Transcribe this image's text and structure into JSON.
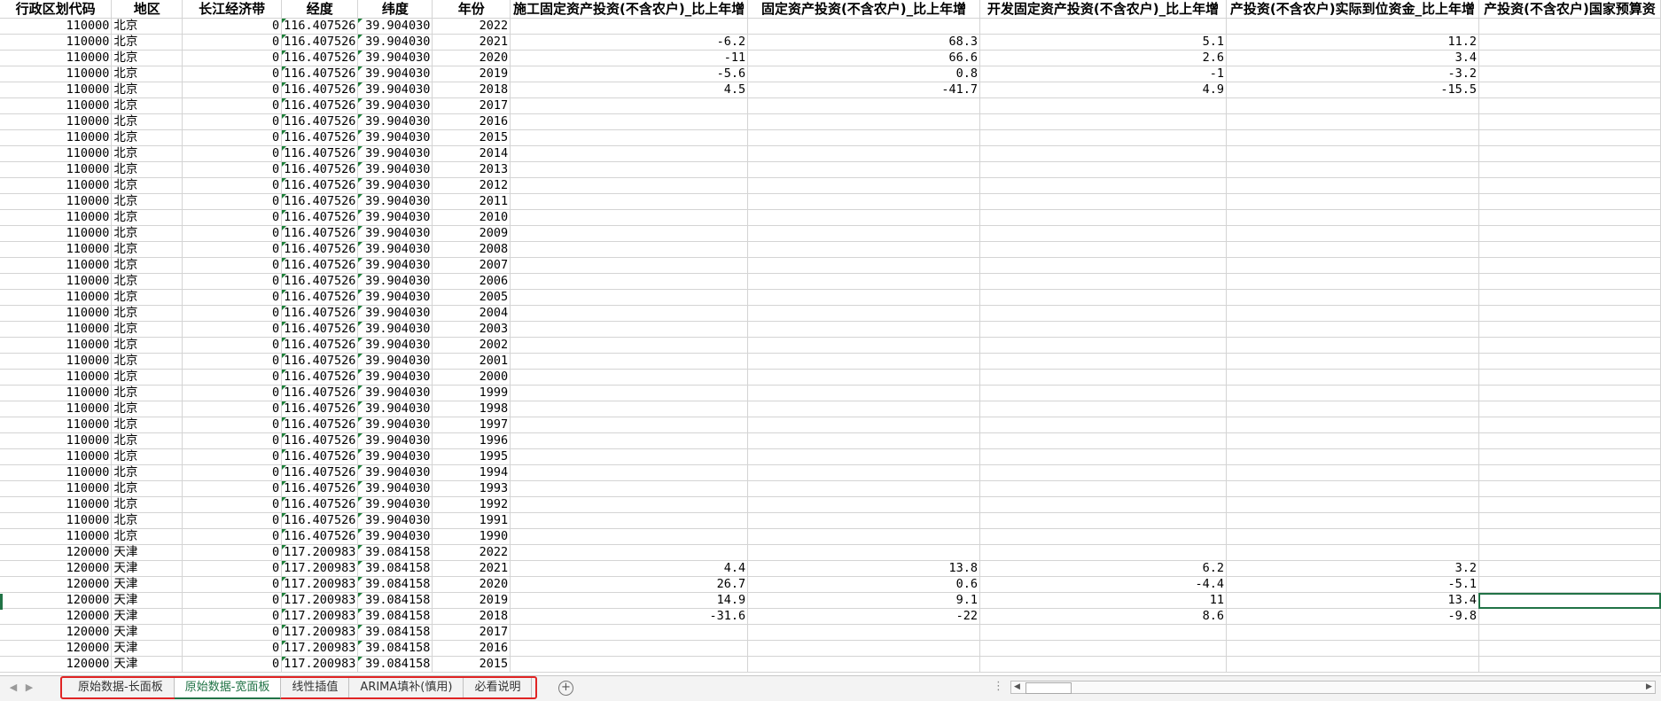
{
  "sheet": {
    "headers": [
      "行政区划代码",
      "地区",
      "长江经济带",
      "经度",
      "纬度",
      "年份",
      "施工固定资产投资(不含农户)_比上年增",
      "固定资产投资(不含农户)_比上年增",
      "开发固定资产投资(不含农户)_比上年增",
      "产投资(不含农户)实际到位资金_比上年增",
      "产投资(不含农户)国家预算资"
    ],
    "rows": [
      [
        "110000",
        "北京",
        "0",
        "116.407526",
        "39.904030",
        "2022",
        "",
        "",
        "",
        "",
        ""
      ],
      [
        "110000",
        "北京",
        "0",
        "116.407526",
        "39.904030",
        "2021",
        "-6.2",
        "68.3",
        "5.1",
        "11.2",
        ""
      ],
      [
        "110000",
        "北京",
        "0",
        "116.407526",
        "39.904030",
        "2020",
        "-11",
        "66.6",
        "2.6",
        "3.4",
        ""
      ],
      [
        "110000",
        "北京",
        "0",
        "116.407526",
        "39.904030",
        "2019",
        "-5.6",
        "0.8",
        "-1",
        "-3.2",
        ""
      ],
      [
        "110000",
        "北京",
        "0",
        "116.407526",
        "39.904030",
        "2018",
        "4.5",
        "-41.7",
        "4.9",
        "-15.5",
        ""
      ],
      [
        "110000",
        "北京",
        "0",
        "116.407526",
        "39.904030",
        "2017",
        "",
        "",
        "",
        "",
        ""
      ],
      [
        "110000",
        "北京",
        "0",
        "116.407526",
        "39.904030",
        "2016",
        "",
        "",
        "",
        "",
        ""
      ],
      [
        "110000",
        "北京",
        "0",
        "116.407526",
        "39.904030",
        "2015",
        "",
        "",
        "",
        "",
        ""
      ],
      [
        "110000",
        "北京",
        "0",
        "116.407526",
        "39.904030",
        "2014",
        "",
        "",
        "",
        "",
        ""
      ],
      [
        "110000",
        "北京",
        "0",
        "116.407526",
        "39.904030",
        "2013",
        "",
        "",
        "",
        "",
        ""
      ],
      [
        "110000",
        "北京",
        "0",
        "116.407526",
        "39.904030",
        "2012",
        "",
        "",
        "",
        "",
        ""
      ],
      [
        "110000",
        "北京",
        "0",
        "116.407526",
        "39.904030",
        "2011",
        "",
        "",
        "",
        "",
        ""
      ],
      [
        "110000",
        "北京",
        "0",
        "116.407526",
        "39.904030",
        "2010",
        "",
        "",
        "",
        "",
        ""
      ],
      [
        "110000",
        "北京",
        "0",
        "116.407526",
        "39.904030",
        "2009",
        "",
        "",
        "",
        "",
        ""
      ],
      [
        "110000",
        "北京",
        "0",
        "116.407526",
        "39.904030",
        "2008",
        "",
        "",
        "",
        "",
        ""
      ],
      [
        "110000",
        "北京",
        "0",
        "116.407526",
        "39.904030",
        "2007",
        "",
        "",
        "",
        "",
        ""
      ],
      [
        "110000",
        "北京",
        "0",
        "116.407526",
        "39.904030",
        "2006",
        "",
        "",
        "",
        "",
        ""
      ],
      [
        "110000",
        "北京",
        "0",
        "116.407526",
        "39.904030",
        "2005",
        "",
        "",
        "",
        "",
        ""
      ],
      [
        "110000",
        "北京",
        "0",
        "116.407526",
        "39.904030",
        "2004",
        "",
        "",
        "",
        "",
        ""
      ],
      [
        "110000",
        "北京",
        "0",
        "116.407526",
        "39.904030",
        "2003",
        "",
        "",
        "",
        "",
        ""
      ],
      [
        "110000",
        "北京",
        "0",
        "116.407526",
        "39.904030",
        "2002",
        "",
        "",
        "",
        "",
        ""
      ],
      [
        "110000",
        "北京",
        "0",
        "116.407526",
        "39.904030",
        "2001",
        "",
        "",
        "",
        "",
        ""
      ],
      [
        "110000",
        "北京",
        "0",
        "116.407526",
        "39.904030",
        "2000",
        "",
        "",
        "",
        "",
        ""
      ],
      [
        "110000",
        "北京",
        "0",
        "116.407526",
        "39.904030",
        "1999",
        "",
        "",
        "",
        "",
        ""
      ],
      [
        "110000",
        "北京",
        "0",
        "116.407526",
        "39.904030",
        "1998",
        "",
        "",
        "",
        "",
        ""
      ],
      [
        "110000",
        "北京",
        "0",
        "116.407526",
        "39.904030",
        "1997",
        "",
        "",
        "",
        "",
        ""
      ],
      [
        "110000",
        "北京",
        "0",
        "116.407526",
        "39.904030",
        "1996",
        "",
        "",
        "",
        "",
        ""
      ],
      [
        "110000",
        "北京",
        "0",
        "116.407526",
        "39.904030",
        "1995",
        "",
        "",
        "",
        "",
        ""
      ],
      [
        "110000",
        "北京",
        "0",
        "116.407526",
        "39.904030",
        "1994",
        "",
        "",
        "",
        "",
        ""
      ],
      [
        "110000",
        "北京",
        "0",
        "116.407526",
        "39.904030",
        "1993",
        "",
        "",
        "",
        "",
        ""
      ],
      [
        "110000",
        "北京",
        "0",
        "116.407526",
        "39.904030",
        "1992",
        "",
        "",
        "",
        "",
        ""
      ],
      [
        "110000",
        "北京",
        "0",
        "116.407526",
        "39.904030",
        "1991",
        "",
        "",
        "",
        "",
        ""
      ],
      [
        "110000",
        "北京",
        "0",
        "116.407526",
        "39.904030",
        "1990",
        "",
        "",
        "",
        "",
        ""
      ],
      [
        "120000",
        "天津",
        "0",
        "117.200983",
        "39.084158",
        "2022",
        "",
        "",
        "",
        "",
        ""
      ],
      [
        "120000",
        "天津",
        "0",
        "117.200983",
        "39.084158",
        "2021",
        "4.4",
        "13.8",
        "6.2",
        "3.2",
        ""
      ],
      [
        "120000",
        "天津",
        "0",
        "117.200983",
        "39.084158",
        "2020",
        "26.7",
        "0.6",
        "-4.4",
        "-5.1",
        ""
      ],
      [
        "120000",
        "天津",
        "0",
        "117.200983",
        "39.084158",
        "2019",
        "14.9",
        "9.1",
        "11",
        "13.4",
        ""
      ],
      [
        "120000",
        "天津",
        "0",
        "117.200983",
        "39.084158",
        "2018",
        "-31.6",
        "-22",
        "8.6",
        "-9.8",
        ""
      ],
      [
        "120000",
        "天津",
        "0",
        "117.200983",
        "39.084158",
        "2017",
        "",
        "",
        "",
        "",
        ""
      ],
      [
        "120000",
        "天津",
        "0",
        "117.200983",
        "39.084158",
        "2016",
        "",
        "",
        "",
        "",
        ""
      ],
      [
        "120000",
        "天津",
        "0",
        "117.200983",
        "39.084158",
        "2015",
        "",
        "",
        "",
        "",
        ""
      ]
    ]
  },
  "tabs": [
    {
      "label": "原始数据-长面板",
      "active": false
    },
    {
      "label": "原始数据-宽面板",
      "active": true
    },
    {
      "label": "线性插值",
      "active": false
    },
    {
      "label": "ARIMA填补(慎用)",
      "active": false
    },
    {
      "label": "必看说明",
      "active": false
    }
  ],
  "nav": {
    "prev": "◀",
    "next": "▶",
    "more": "⋮",
    "add": "+"
  },
  "colors": {
    "accent": "#217346",
    "highlight_border": "#e02424",
    "gridline": "#d4d4d4"
  }
}
